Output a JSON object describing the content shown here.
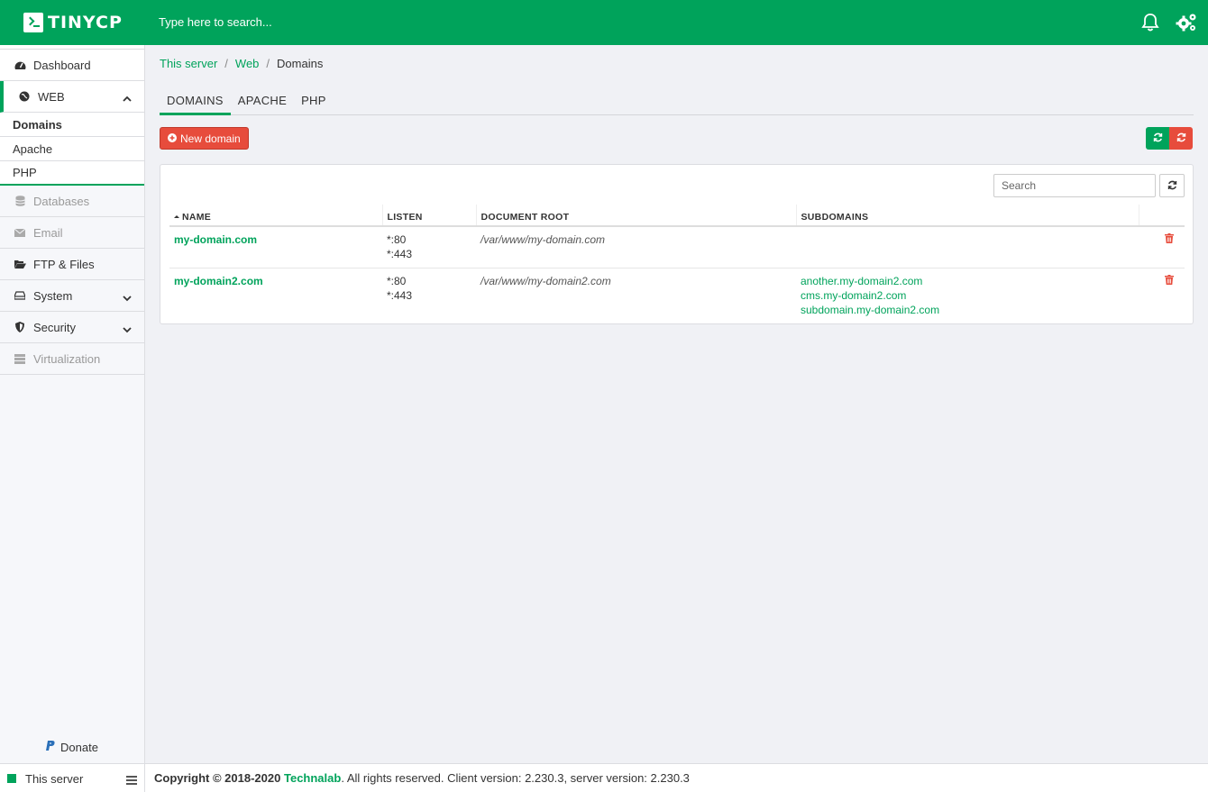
{
  "app": {
    "logo_text": "TINYCP"
  },
  "topbar": {
    "search_placeholder": "Type here to search...",
    "icons": [
      "bell-icon",
      "gears-icon"
    ]
  },
  "sidebar": {
    "items": [
      {
        "label": "Dashboard",
        "icon": "dashboard-icon"
      },
      {
        "label": "WEB",
        "icon": "globe-icon",
        "expanded": true
      },
      {
        "label": "Databases",
        "icon": "database-icon"
      },
      {
        "label": "Email",
        "icon": "envelope-icon"
      },
      {
        "label": "FTP & Files",
        "icon": "folder-icon"
      },
      {
        "label": "System",
        "icon": "hdd-icon"
      },
      {
        "label": "Security",
        "icon": "shield-icon"
      },
      {
        "label": "Virtualization",
        "icon": "server-icon"
      }
    ],
    "web_subitems": [
      "Domains",
      "Apache",
      "PHP"
    ],
    "donate_label": "Donate"
  },
  "footer": {
    "server_label": "This server",
    "copyright": "Copyright © 2018-2020",
    "brand": "Technalab",
    "rest": ". All rights reserved. Client version: 2.230.3, server version: 2.230.3"
  },
  "breadcrumb": {
    "items": [
      "This server",
      "Web",
      "Domains"
    ]
  },
  "tabs": [
    "DOMAINS",
    "APACHE",
    "PHP"
  ],
  "actions": {
    "new_domain": "New domain"
  },
  "table": {
    "search_placeholder": "Search",
    "columns": [
      "NAME",
      "LISTEN",
      "DOCUMENT ROOT",
      "SUBDOMAINS"
    ],
    "rows": [
      {
        "name": "my-domain.com",
        "listen": [
          "*:80",
          "*:443"
        ],
        "root": "/var/www/my-domain.com",
        "subdomains": []
      },
      {
        "name": "my-domain2.com",
        "listen": [
          "*:80",
          "*:443"
        ],
        "root": "/var/www/my-domain2.com",
        "subdomains": [
          "another.my-domain2.com",
          "cms.my-domain2.com",
          "subdomain.my-domain2.com"
        ]
      }
    ]
  },
  "colors": {
    "brand_green": "#00a35b",
    "danger_red": "#e74c3c"
  }
}
